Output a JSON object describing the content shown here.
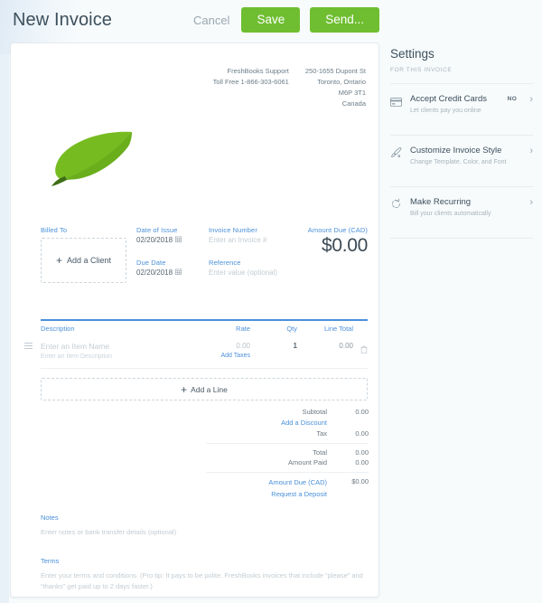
{
  "header": {
    "title": "New Invoice",
    "cancel_label": "Cancel",
    "save_label": "Save",
    "send_label": "Send...",
    "accent_green": "#6fbe31",
    "link_blue": "#4a90d9"
  },
  "company": {
    "left": [
      "FreshBooks Support",
      "Toll Free 1-866-303-6061"
    ],
    "right": [
      "250-1655 Dupont St",
      "Toronto, Ontario",
      "M6P 3T1",
      "Canada"
    ]
  },
  "logo": {
    "name": "leaf-logo",
    "leaf_color": "#76bc21",
    "leaf_color_dark": "#58a01a",
    "stem_color": "#3f6d16"
  },
  "meta": {
    "billed_to_label": "Billed To",
    "add_client_label": "Add a Client",
    "date_of_issue_label": "Date of Issue",
    "date_of_issue_value": "02/20/2018",
    "due_date_label": "Due Date",
    "due_date_value": "02/20/2018",
    "invoice_number_label": "Invoice Number",
    "invoice_number_placeholder": "Enter an Invoice #",
    "reference_label": "Reference",
    "reference_placeholder": "Enter value (optional)",
    "amount_due_label": "Amount Due (CAD)",
    "amount_due_value": "$0.00"
  },
  "items": {
    "columns": {
      "description": "Description",
      "rate": "Rate",
      "qty": "Qty",
      "line_total": "Line Total"
    },
    "rows": [
      {
        "name_placeholder": "Enter an Item Name",
        "desc_placeholder": "Enter an Item Description",
        "rate": "0.00",
        "add_taxes": "Add Taxes",
        "qty": "1",
        "line_total": "0.00"
      }
    ],
    "add_line_label": "Add a Line"
  },
  "totals": {
    "subtotal_label": "Subtotal",
    "subtotal_value": "0.00",
    "add_discount_label": "Add a Discount",
    "tax_label": "Tax",
    "tax_value": "0.00",
    "total_label": "Total",
    "total_value": "0.00",
    "amount_paid_label": "Amount Paid",
    "amount_paid_value": "0.00",
    "amount_due_label": "Amount Due (CAD)",
    "amount_due_value": "$0.00",
    "request_deposit_label": "Request a Deposit"
  },
  "notes": {
    "label": "Notes",
    "placeholder": "Enter notes or bank transfer details (optional)"
  },
  "terms": {
    "label": "Terms",
    "placeholder": "Enter your terms and conditions. (Pro tip: It pays to be polite. FreshBooks invoices that include “please” and “thanks” get paid up to 2 days faster.)"
  },
  "settings": {
    "title": "Settings",
    "subtitle": "FOR THIS INVOICE",
    "items": [
      {
        "icon": "credit-card-icon",
        "name": "Accept Credit Cards",
        "desc": "Let clients pay you online",
        "status": "NO"
      },
      {
        "icon": "paint-brush-icon",
        "name": "Customize Invoice Style",
        "desc": "Change Template, Color, and Font",
        "status": ""
      },
      {
        "icon": "refresh-icon",
        "name": "Make Recurring",
        "desc": "Bill your clients automatically",
        "status": ""
      }
    ]
  }
}
